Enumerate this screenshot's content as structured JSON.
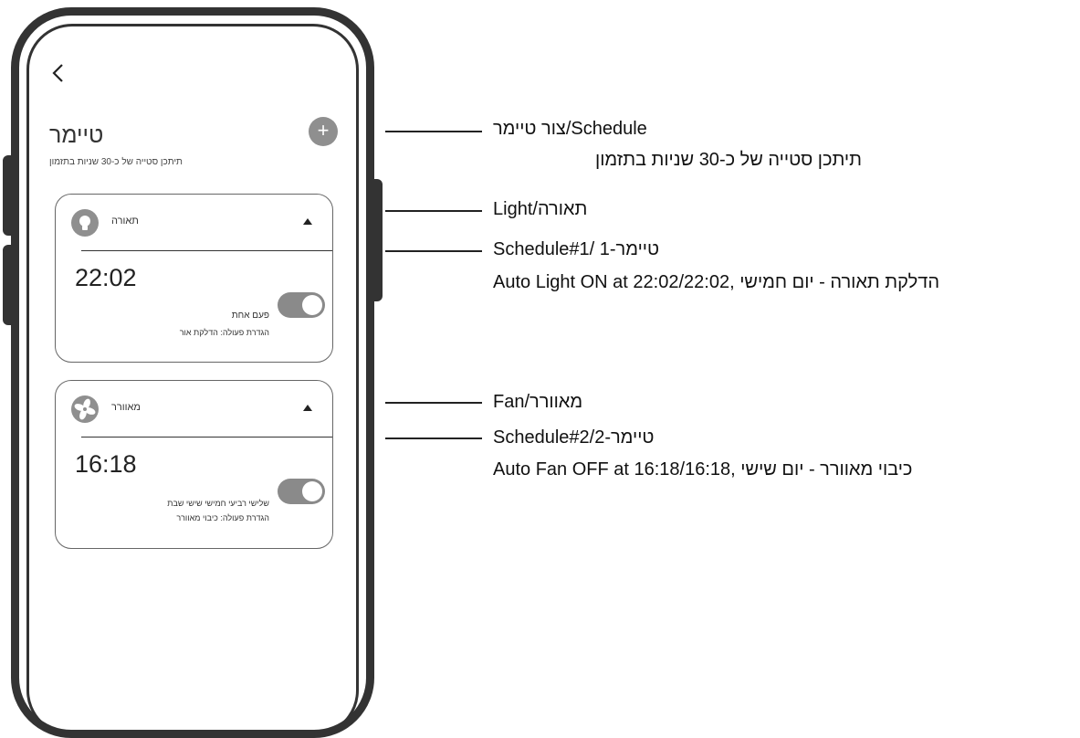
{
  "screen": {
    "title": "טיימר",
    "subtitle": "תיתכן סטייה של כ-30 שניות בתזמון",
    "add_icon": "+",
    "back_icon": "chevron-left-icon"
  },
  "cards": [
    {
      "device_name": "תאורה",
      "icon": "lightbulb-icon",
      "time": "22:02",
      "repeat": "פעם אחת",
      "action": "הגדרת פעולה: הדלקת אור",
      "toggle_on": true
    },
    {
      "device_name": "מאוורר",
      "icon": "fan-icon",
      "time": "16:18",
      "repeat": "שלישי רביעי חמישי שישי שבת",
      "action": "הגדרת פעולה: כיבוי מאוורר",
      "toggle_on": true
    }
  ],
  "callouts": {
    "schedule": "צור טיימר/Schedule",
    "drift_note": "תיתכן סטייה של כ-30 שניות בתזמון",
    "light": "Light/תאורה",
    "schedule1": "Schedule#1/ 1-טיימר",
    "schedule1_desc": "Auto Light ON at 22:02/22:02, הדלקת תאורה - יום חמישי",
    "fan": "Fan/מאוורר",
    "schedule2": "Schedule#2/2-טיימר",
    "schedule2_desc": "Auto Fan OFF at 16:18/16:18, כיבוי מאוורר - יום שישי"
  },
  "colors": {
    "frame": "#333333",
    "icon_bg": "#8f8f8f",
    "toggle": "#8a8a8a"
  }
}
